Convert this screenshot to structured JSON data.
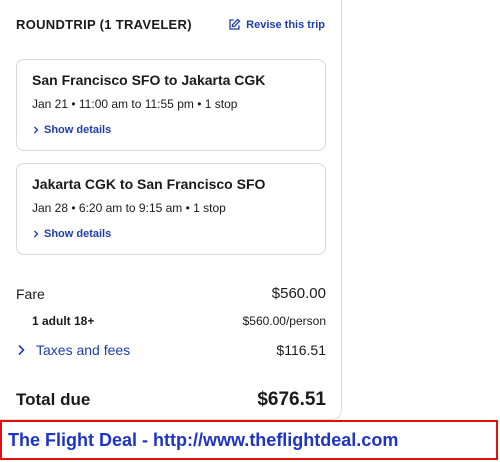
{
  "header": {
    "trip_type": "ROUNDTRIP (1 TRAVELER)",
    "revise_label": "Revise this trip"
  },
  "flights": [
    {
      "route": "San Francisco SFO to Jakarta CGK",
      "details": "Jan 21 • 11:00 am to 11:55 pm • 1 stop",
      "show_details": "Show details"
    },
    {
      "route": "Jakarta CGK to San Francisco SFO",
      "details": "Jan 28 • 6:20 am to 9:15 am • 1 stop",
      "show_details": "Show details"
    }
  ],
  "pricing": {
    "fare_label": "Fare",
    "fare_amount": "$560.00",
    "adult_label": "1 adult 18+",
    "adult_amount": "$560.00/person",
    "taxes_label": "Taxes and fees",
    "taxes_amount": "$116.51",
    "total_label": "Total due",
    "total_amount": "$676.51"
  },
  "banner": {
    "text": "The Flight Deal - http://www.theflightdeal.com"
  },
  "colors": {
    "link": "#1f3ea8",
    "banner_border": "#e01010",
    "banner_text": "#1e34c8"
  }
}
